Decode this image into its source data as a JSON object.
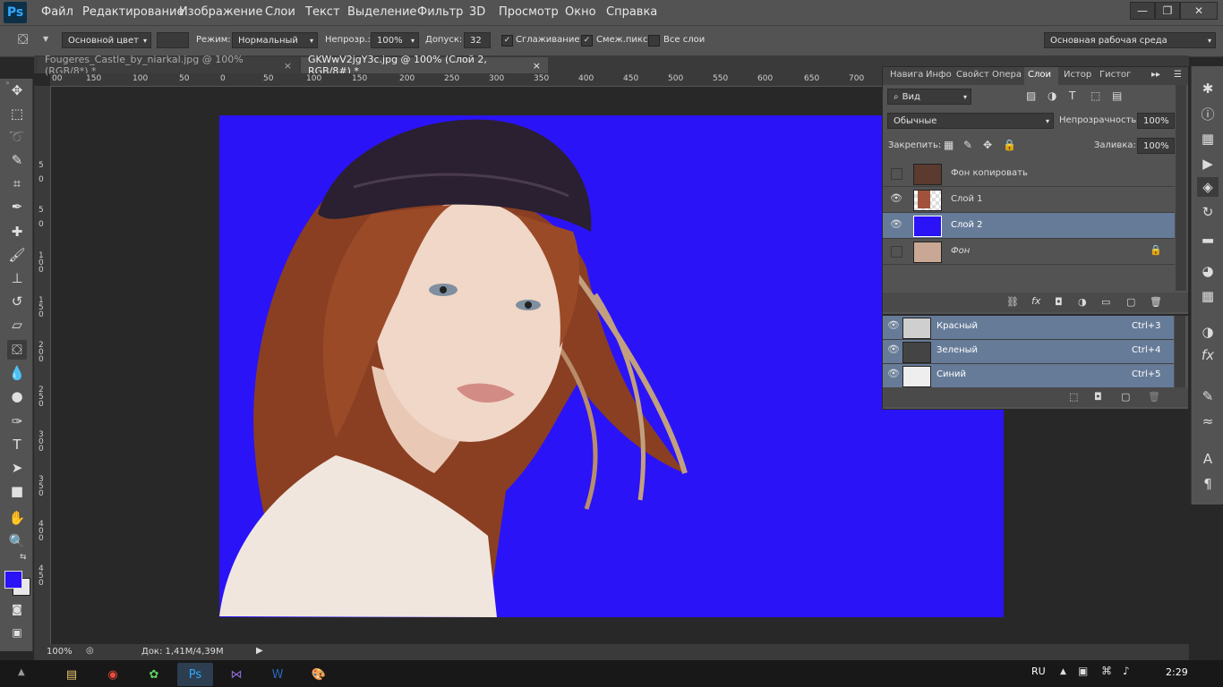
{
  "app": {
    "logo": "Ps"
  },
  "menu": [
    "Файл",
    "Редактирование",
    "Изображение",
    "Слои",
    "Текст",
    "Выделение",
    "Фильтр",
    "3D",
    "Просмотр",
    "Окно",
    "Справка"
  ],
  "window_controls": {
    "minimize": "—",
    "restore": "❐",
    "close": "✕"
  },
  "options": {
    "source": "Основной цвет",
    "mode_label": "Режим:",
    "mode_value": "Нормальный",
    "opacity_label": "Непрозр.:",
    "opacity_value": "100%",
    "tolerance_label": "Допуск:",
    "tolerance_value": "32",
    "antialias_label": "Сглаживание",
    "contiguous_label": "Смеж.пикс",
    "all_layers_label": "Все слои",
    "workspace": "Основная рабочая среда"
  },
  "tabs": [
    {
      "label": "Fougeres_Castle_by_niarkal.jpg @ 100% (RGB/8*) *",
      "close": "×"
    },
    {
      "label": "GKWwV2jgY3c.jpg @ 100% (Слой 2, RGB/8#) *",
      "close": "×"
    }
  ],
  "ruler": {
    "h": [
      "00",
      "150",
      "100",
      "50",
      "0",
      "50",
      "100",
      "150",
      "200",
      "250",
      "300",
      "350",
      "400",
      "450",
      "500",
      "550",
      "600",
      "650",
      "700"
    ],
    "v": [
      "5",
      "0",
      "5",
      "0",
      "1 0 0",
      "1 5 0",
      "2 0 0",
      "2 5 0",
      "3 0 0",
      "3 5 0",
      "4 0 0",
      "4 5 0"
    ]
  },
  "status": {
    "zoom": "100%",
    "doc": "Док: 1,41M/4,39M"
  },
  "layers_panel": {
    "tabs": [
      "Навига",
      "Инфо",
      "Свойст",
      "Опера",
      "Слои",
      "Истор",
      "Гистог"
    ],
    "filter": "Вид",
    "blend_mode": "Обычные",
    "opacity_label": "Непрозрачность:",
    "opacity_value": "100%",
    "lock_label": "Закрепить:",
    "fill_label": "Заливка:",
    "fill_value": "100%",
    "layers": [
      {
        "name": "Фон копировать",
        "visible": false,
        "selected": false
      },
      {
        "name": "Слой 1",
        "visible": true,
        "selected": false
      },
      {
        "name": "Слой 2",
        "visible": true,
        "selected": true
      },
      {
        "name": "Фон",
        "visible": false,
        "selected": false,
        "locked": true
      }
    ]
  },
  "channels_panel": {
    "channels": [
      {
        "name": "Красный",
        "shortcut": "Ctrl+3"
      },
      {
        "name": "Зеленый",
        "shortcut": "Ctrl+4"
      },
      {
        "name": "Синий",
        "shortcut": "Ctrl+5"
      }
    ]
  },
  "colors": {
    "foreground": "#2b13f7",
    "background": "#e8e8e8",
    "canvas": "#2b13f7",
    "selected_layer": "#667b98"
  },
  "taskbar": {
    "lang": "RU",
    "time": "2:29"
  }
}
